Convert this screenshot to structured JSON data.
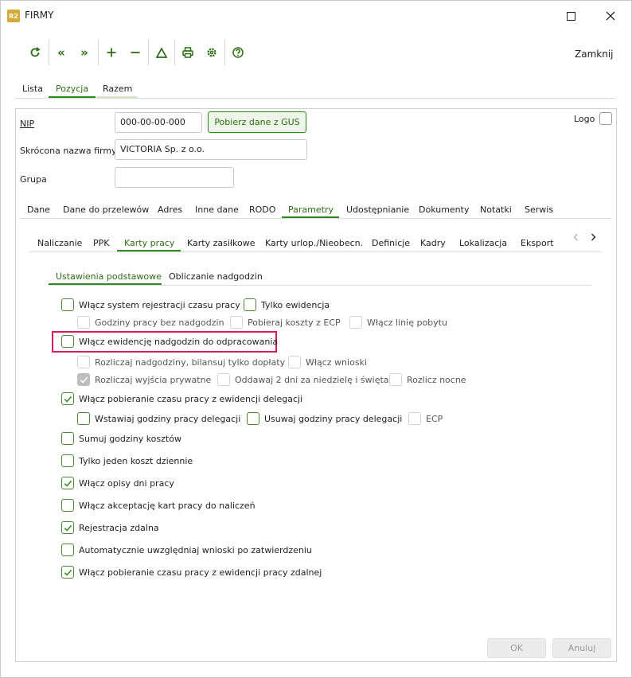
{
  "window": {
    "app_icon": "R2",
    "title": "FIRMY"
  },
  "toolbar": {
    "icons": [
      "refresh-icon",
      "first-icon",
      "last-icon",
      "add-icon",
      "remove-icon",
      "filter-icon",
      "print-icon",
      "settings-icon",
      "help-icon"
    ],
    "close_label": "Zamknij"
  },
  "top_tabs": [
    {
      "label": "Lista"
    },
    {
      "label": "Pozycja"
    },
    {
      "label": "Razem"
    }
  ],
  "form": {
    "nip_label": "NIP",
    "nip_value": "000-00-00-000",
    "gus_button": "Pobierz dane z GUS",
    "short_name_label": "Skrócona nazwa firmy",
    "short_name_value": "VICTORIA Sp. z o.o.",
    "group_label": "Grupa",
    "group_value": "",
    "logo_label": "Logo"
  },
  "main_tabs": [
    "Dane",
    "Dane do przelewów",
    "Adres",
    "Inne dane",
    "RODO",
    "Parametry",
    "Udostępnianie",
    "Dokumenty",
    "Notatki",
    "Serwis"
  ],
  "sub_tabs": [
    "Naliczanie",
    "PPK",
    "Karty pracy",
    "Karty zasiłkowe",
    "Karty urlop./Nieobecn.",
    "Definicje",
    "Kadry",
    "Lokalizacja",
    "Eksport"
  ],
  "settings_tabs": [
    "Ustawienia podstawowe",
    "Obliczanie nadgodzin"
  ],
  "options": {
    "o1": "Włącz system rejestracji czasu pracy",
    "o2": "Tylko ewidencja",
    "o3": "Godziny pracy bez nadgodzin",
    "o4": "Pobieraj koszty z ECP",
    "o5": "Włącz linię pobytu",
    "o6": "Włącz ewidencję nadgodzin do odpracowania",
    "o7": "Rozliczaj nadgodziny, bilansuj tylko dopłaty",
    "o8": "Włącz wnioski",
    "o9": "Rozliczaj wyjścia prywatne",
    "o10": "Oddawaj 2 dni za niedzielę i święta",
    "o11": "Rozlicz nocne",
    "o12": "Włącz pobieranie czasu pracy z ewidencji delegacji",
    "o13": "Wstawiaj godziny pracy delegacji",
    "o14": "Usuwaj godziny pracy delegacji",
    "o15": "ECP",
    "o16": "Sumuj godziny kosztów",
    "o17": "Tylko jeden koszt dziennie",
    "o18": "Włącz opisy dni pracy",
    "o19": "Włącz akceptację kart pracy do naliczeń",
    "o20": "Rejestracja zdalna",
    "o21": "Automatycznie uwzględniaj wnioski po zatwierdzeniu",
    "o22": "Włącz pobieranie czasu pracy z ewidencji pracy zdalnej"
  },
  "checked_options": [
    "o12",
    "o18",
    "o20",
    "o22"
  ],
  "checked_disabled_options": [
    "o9"
  ],
  "footer": {
    "ok_label": "OK",
    "cancel_label": "Anuluj"
  },
  "colors": {
    "accent": "#2d8a1e",
    "highlight": "#d81b60"
  }
}
